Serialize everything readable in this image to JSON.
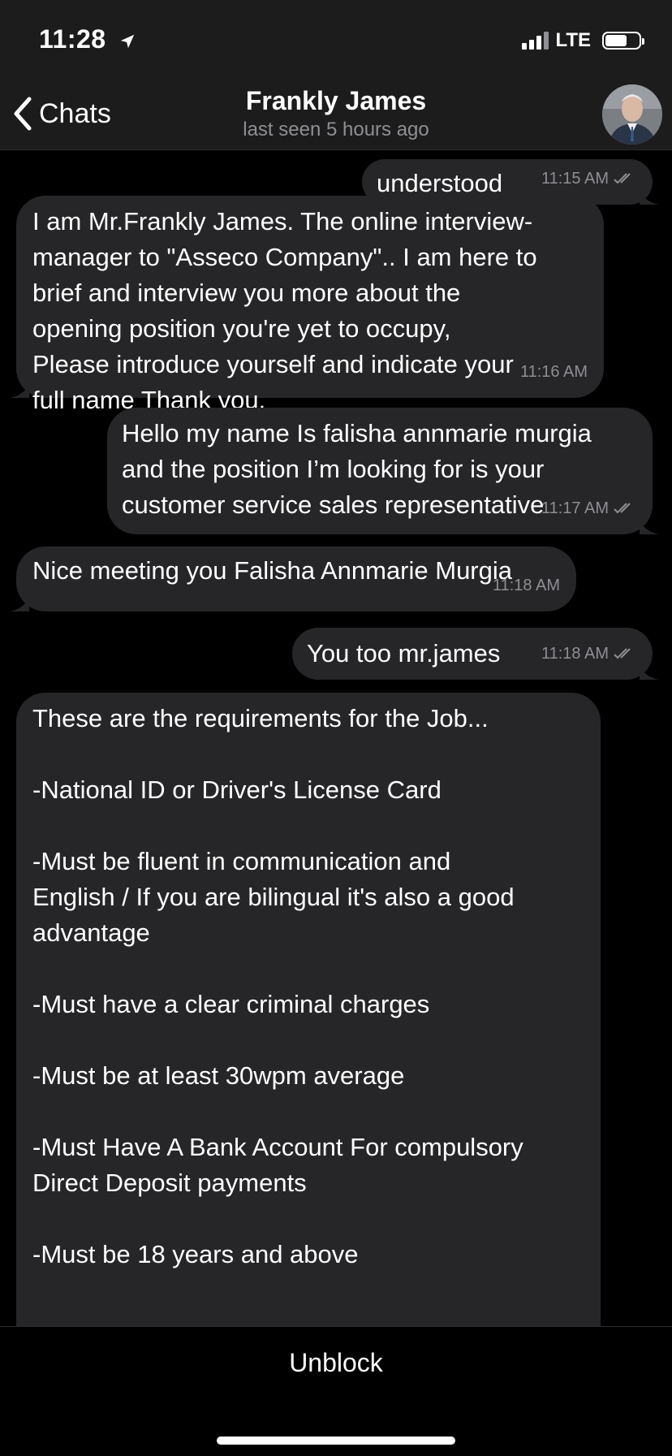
{
  "status_bar": {
    "time": "11:28",
    "network": "LTE",
    "battery_level": 0.65
  },
  "nav": {
    "back_label": "Chats",
    "contact_name": "Frankly James",
    "last_seen": "last seen 5 hours ago"
  },
  "messages": [
    {
      "direction": "outgoing",
      "text": "understood",
      "time": "11:15 AM",
      "read": true
    },
    {
      "direction": "incoming",
      "text": "I am Mr.Frankly James. The online interview-\nmanager to \"Asseco Company\".. I am here to\nbrief and interview you more about the\nopening position you're yet to occupy,\nPlease introduce yourself and indicate your\nfull name Thank you.",
      "time": "11:16 AM"
    },
    {
      "direction": "outgoing",
      "text": "Hello my name Is falisha annmarie murgia\nand the position I’m looking for is your\ncustomer service sales representative",
      "time": "11:17 AM",
      "read": true
    },
    {
      "direction": "incoming",
      "text": "Nice meeting you Falisha Annmarie Murgia",
      "time": "11:18 AM"
    },
    {
      "direction": "outgoing",
      "text": "You too mr.james",
      "time": "11:18 AM",
      "read": true
    },
    {
      "direction": "incoming",
      "text": "These are the requirements for the Job...\n\n-National ID or Driver's License Card\n\n-Must be fluent in communication and\nEnglish / If you are bilingual it's also a good\nadvantage\n\n-Must have a clear criminal charges\n\n-Must be at least 30wpm average\n\n-Must Have A Bank Account For compulsory\nDirect Deposit payments\n\n-Must be 18 years and above"
    }
  ],
  "bottom": {
    "action_label": "Unblock"
  },
  "colors": {
    "bubble": "#262628",
    "bar": "#1c1c1d",
    "meta_text": "#8e8e93"
  },
  "icons": [
    "location-arrow-icon",
    "signal-icon",
    "battery-icon",
    "back-chevron-icon",
    "double-check-icon",
    "chevron-down-icon"
  ]
}
